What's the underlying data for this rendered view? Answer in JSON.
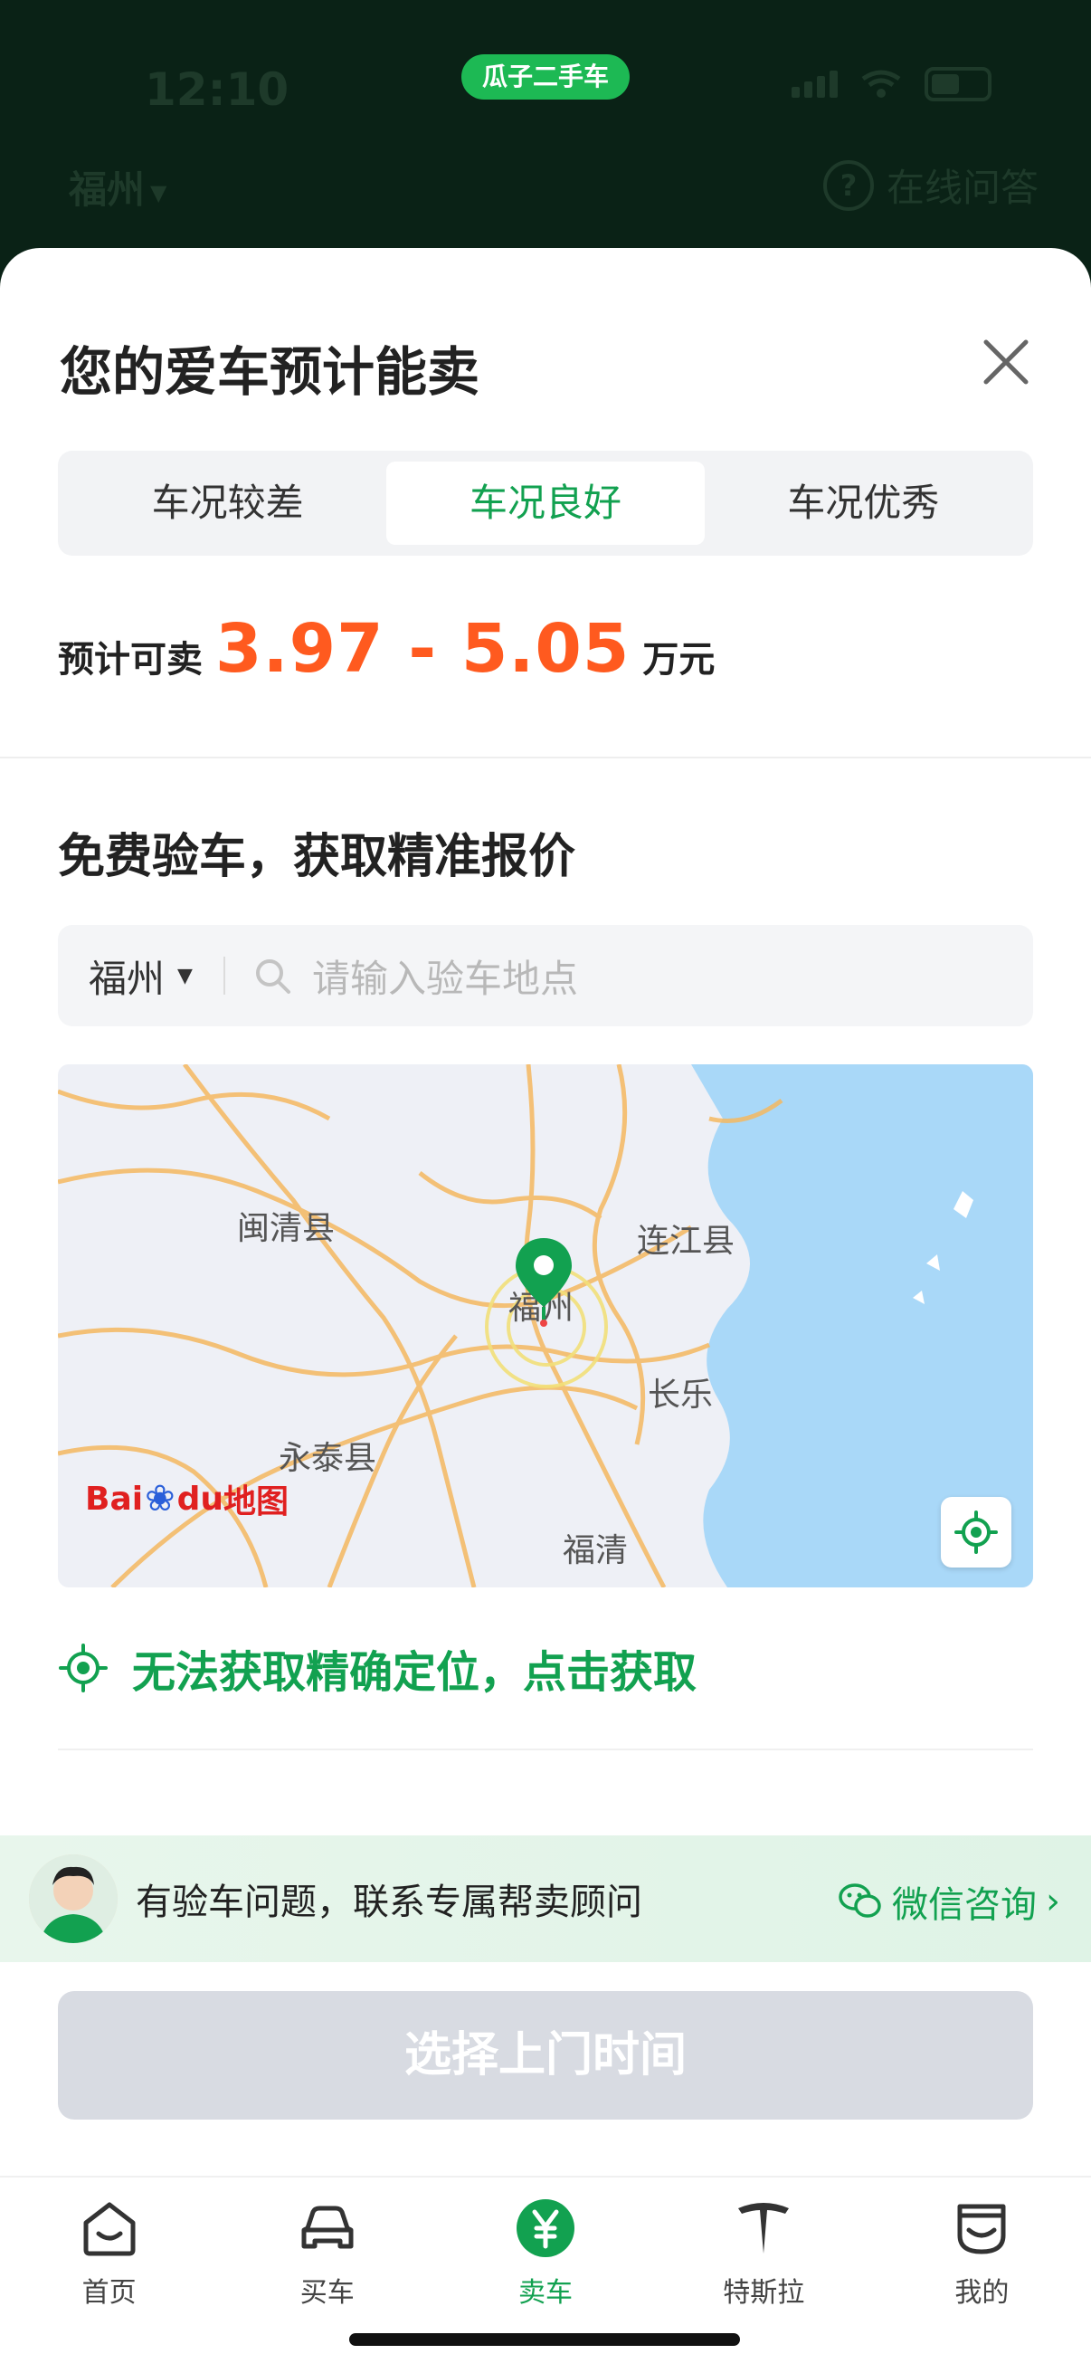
{
  "status_bar": {
    "time": "12:10",
    "app_badge": "瓜子二手车",
    "battery": "4"
  },
  "header": {
    "city": "福州",
    "qa_label": "在线问答"
  },
  "sheet": {
    "title": "您的爱车预计能卖",
    "tabs": [
      {
        "label": "车况较差",
        "active": false
      },
      {
        "label": "车况良好",
        "active": true
      },
      {
        "label": "车况优秀",
        "active": false
      }
    ],
    "price": {
      "label": "预计可卖",
      "range": "3.97 - 5.05",
      "unit": "万元"
    }
  },
  "inspection": {
    "title": "免费验车，获取精准报价",
    "city": "福州",
    "search_placeholder": "请输入验车地点",
    "map": {
      "labels": [
        "闽清县",
        "连江县",
        "福州",
        "长乐",
        "永泰县",
        "福清"
      ],
      "logo_text_1": "Bai",
      "logo_text_2": "du",
      "logo_text_3": "地图"
    },
    "location_link": "无法获取精确定位，点击获取"
  },
  "consult": {
    "message": "有验车问题，联系专属帮卖顾问",
    "action": "微信咨询"
  },
  "cta": {
    "label": "选择上门时间"
  },
  "tabbar": [
    {
      "label": "首页",
      "icon": "home-icon",
      "active": false
    },
    {
      "label": "买车",
      "icon": "car-icon",
      "active": false
    },
    {
      "label": "卖车",
      "icon": "yen-icon",
      "active": true
    },
    {
      "label": "特斯拉",
      "icon": "tesla-icon",
      "active": false
    },
    {
      "label": "我的",
      "icon": "profile-icon",
      "active": false
    }
  ],
  "colors": {
    "accent": "#12a150",
    "price": "#ff5a1f",
    "cta_disabled": "#d8dbe2"
  }
}
